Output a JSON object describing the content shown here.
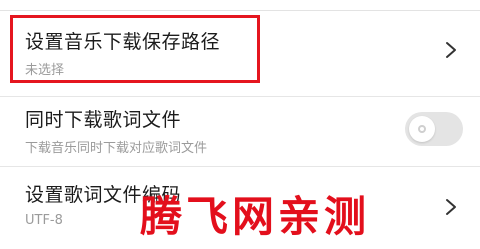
{
  "settings": {
    "items": [
      {
        "title": "设置音乐下载保存路径",
        "subtitle": "未选择",
        "control": "chevron-right-icon"
      },
      {
        "title": "同时下载歌词文件",
        "subtitle": "下载音乐同时下载对应歌词文件",
        "control": "toggle",
        "toggle_on": false
      },
      {
        "title": "设置歌词文件编码",
        "subtitle": "UTF-8",
        "control": "chevron-right-icon"
      }
    ]
  },
  "overlay": {
    "watermark_text": "腾飞网亲测",
    "highlight_color": "#e5161f",
    "watermark_color": "#e30f1c"
  }
}
